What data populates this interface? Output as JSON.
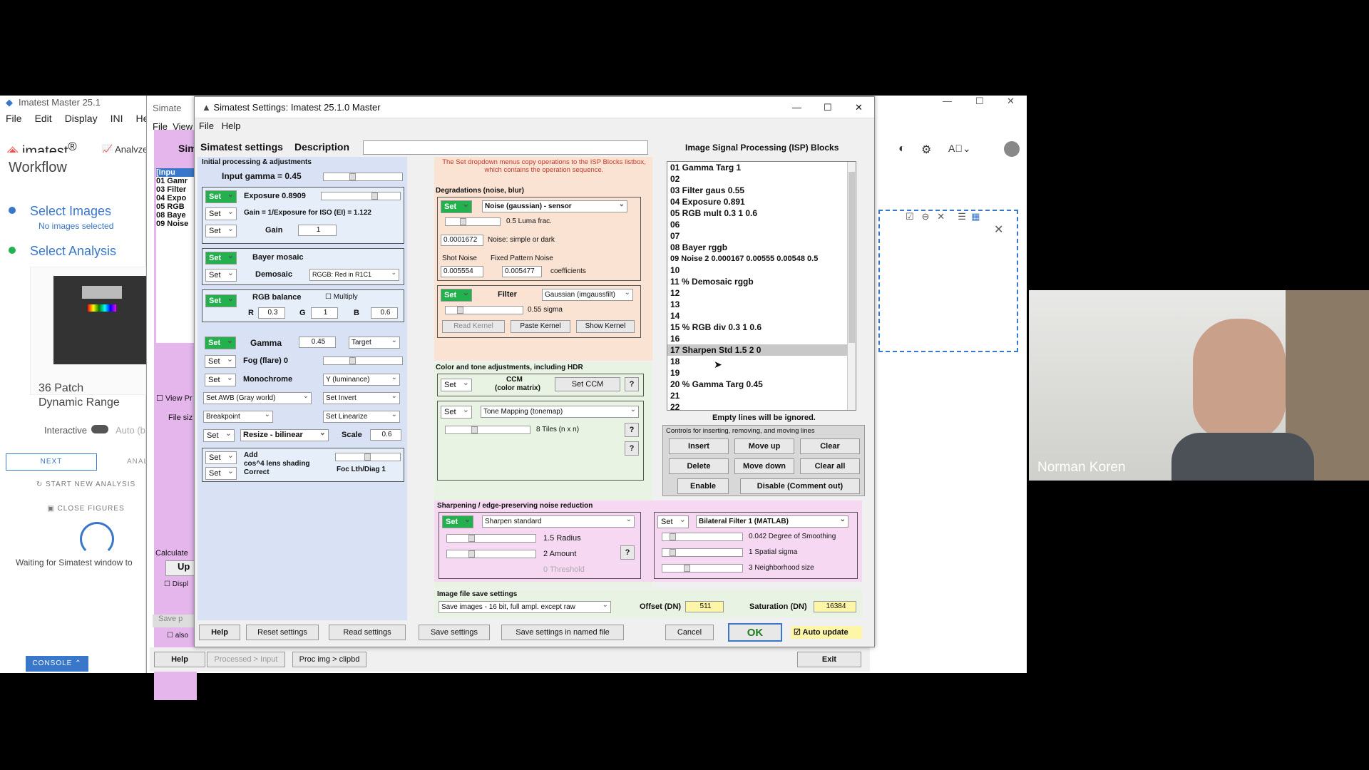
{
  "main_app": {
    "title": "Imatest Master 25.1",
    "menu": [
      "File",
      "Edit",
      "Display",
      "INI",
      "Help"
    ],
    "brand": "imatest",
    "analyze": "Analyze",
    "workflow": "Workflow",
    "select_images": "Select Images",
    "no_images": "No images selected",
    "select_analysis": "Select Analysis",
    "patch_name": "36 Patch",
    "patch_sub": "Dynamic Range",
    "interactive": "Interactive",
    "auto": "Auto (b",
    "next": "NEXT",
    "anal": "ANAL",
    "start_new": "START NEW ANALYSIS",
    "close_figures": "CLOSE FIGURES",
    "waiting": "Waiting for Simatest window to",
    "console": "CONSOLE"
  },
  "win2": {
    "title": "Simate",
    "menu": [
      "File",
      "View"
    ],
    "sim": "Sim",
    "list": [
      "[Inpu",
      "01 Gamr",
      "03 Filter",
      "04 Expo",
      "05 RGB",
      "08 Baye",
      "09 Noise"
    ],
    "view_pr": "View Pr",
    "file_siz": "File siz",
    "calculate": "Calculate",
    "up": "Up",
    "displ": "Displ",
    "save_p": "Save p",
    "also": "also"
  },
  "dialog": {
    "title": "Simatest Settings:  Imatest 25.1.0  Master",
    "menu": [
      "File",
      "Help"
    ],
    "simatest_settings": "Simatest settings",
    "description": "Description",
    "initial_header": "Initial processing & adjustments",
    "input_gamma": "Input gamma = 0.45",
    "exposure": "Exposure  0.8909",
    "gain_eq": "Gain = 1/Exposure for ISO (EI) = 1.122",
    "gain": "Gain",
    "gain_val": "1",
    "bayer_mosaic": "Bayer mosaic",
    "demosaic": "Demosaic",
    "demosaic_val": "RGGB: Red in R1C1",
    "rgb_balance": "RGB balance",
    "multiply": "Multiply",
    "r": "R",
    "r_val": "0.3",
    "g": "G",
    "g_val": "1",
    "b": "B",
    "b_val": "0.6",
    "gamma": "Gamma",
    "gamma_val": "0.45",
    "target": "Target",
    "fog": "Fog (flare)  0",
    "monochrome": "Monochrome",
    "mono_val": "Y (luminance)",
    "set_awb": "Set AWB (Gray world)",
    "set_invert": "Set Invert",
    "breakpoint": "Breakpoint",
    "set_linearize": "Set Linearize",
    "resize": "Resize - bilinear",
    "scale": "Scale",
    "scale_val": "0.6",
    "add": "Add",
    "cos4": "cos^4 lens shading",
    "correct": "Correct",
    "foc": "Foc Lth/Diag 1",
    "set": "Set",
    "notice": "The Set dropdown menus copy operations to the ISP Blocks listbox, which contains the operation sequence.",
    "degradations": "Degradations (noise, blur)",
    "noise_dd": "Noise (gaussian) - sensor",
    "luma_frac": "0.5 Luma frac.",
    "noise_val": "0.0001672",
    "noise_simple": "Noise: simple or dark",
    "shot_noise": "Shot Noise",
    "fpn": "Fixed Pattern Noise",
    "shot_val": "0.005554",
    "fpn_val": "0.005477",
    "coefficients": "coefficients",
    "filter": "Filter",
    "filter_dd": "Gaussian (imgaussfilt)",
    "sigma": "0.55  sigma",
    "read_kernel": "Read Kernel",
    "paste_kernel": "Paste Kernel",
    "show_kernel": "Show Kernel",
    "color_tone": "Color and tone adjustments, including HDR",
    "ccm": "CCM",
    "color_matrix": "(color matrix)",
    "set_ccm": "Set CCM",
    "q": "?",
    "tone_dd": "Tone Mapping (tonemap)",
    "tiles": "8  Tiles (n x n)",
    "sharpening": "Sharpening / edge-preserving noise reduction",
    "sharpen_dd": "Sharpen standard",
    "radius": "1.5  Radius",
    "amount": "2  Amount",
    "threshold": "0  Threshold",
    "bilateral_dd": "Bilateral Filter 1 (MATLAB)",
    "smoothing": "0.042  Degree of Smoothing",
    "spatial": "1  Spatial sigma",
    "neighborhood": "3  Neighborhood size",
    "save_header": "Image file save settings",
    "save_dd": "Save images - 16 bit, full ampl. except raw",
    "offset": "Offset (DN)",
    "offset_val": "511",
    "saturation": "Saturation (DN)",
    "saturation_val": "16384",
    "isp_title": "Image Signal Processing (ISP) Blocks",
    "isp": [
      "01  Gamma Targ 1",
      "02",
      "03  Filter gaus 0.55",
      "04  Exposure 0.891",
      "05  RGB mult 0.3 1 0.6",
      "06",
      "07",
      "08  Bayer rggb",
      "09  Noise 2 0.000167 0.00555  0.00548 0.5",
      "10",
      "11  % Demosaic rggb",
      "12",
      "13",
      "14",
      "15  % RGB div  0.3 1 0.6",
      "16",
      "17  Sharpen Std 1.5 2 0",
      "18",
      "19",
      "20  % Gamma Targ 0.45",
      "21",
      "22"
    ],
    "empty_lines": "Empty lines will be ignored.",
    "controls": "Controls for inserting, removing, and moving lines",
    "insert": "Insert",
    "move_up": "Move up",
    "clear": "Clear",
    "delete": "Delete",
    "move_down": "Move down",
    "clear_all": "Clear all",
    "enable": "Enable",
    "disable": "Disable (Comment out)",
    "help": "Help",
    "reset": "Reset settings",
    "read_settings": "Read settings",
    "save_settings": "Save settings",
    "save_named": "Save settings in named file",
    "cancel": "Cancel",
    "ok": "OK",
    "auto_update": "Auto update"
  },
  "bottom_bar": {
    "help": "Help",
    "processed": "Processed > Input",
    "proc_img": "Proc img > clipbd",
    "exit": "Exit"
  },
  "webcam": {
    "name": "Norman Koren"
  }
}
